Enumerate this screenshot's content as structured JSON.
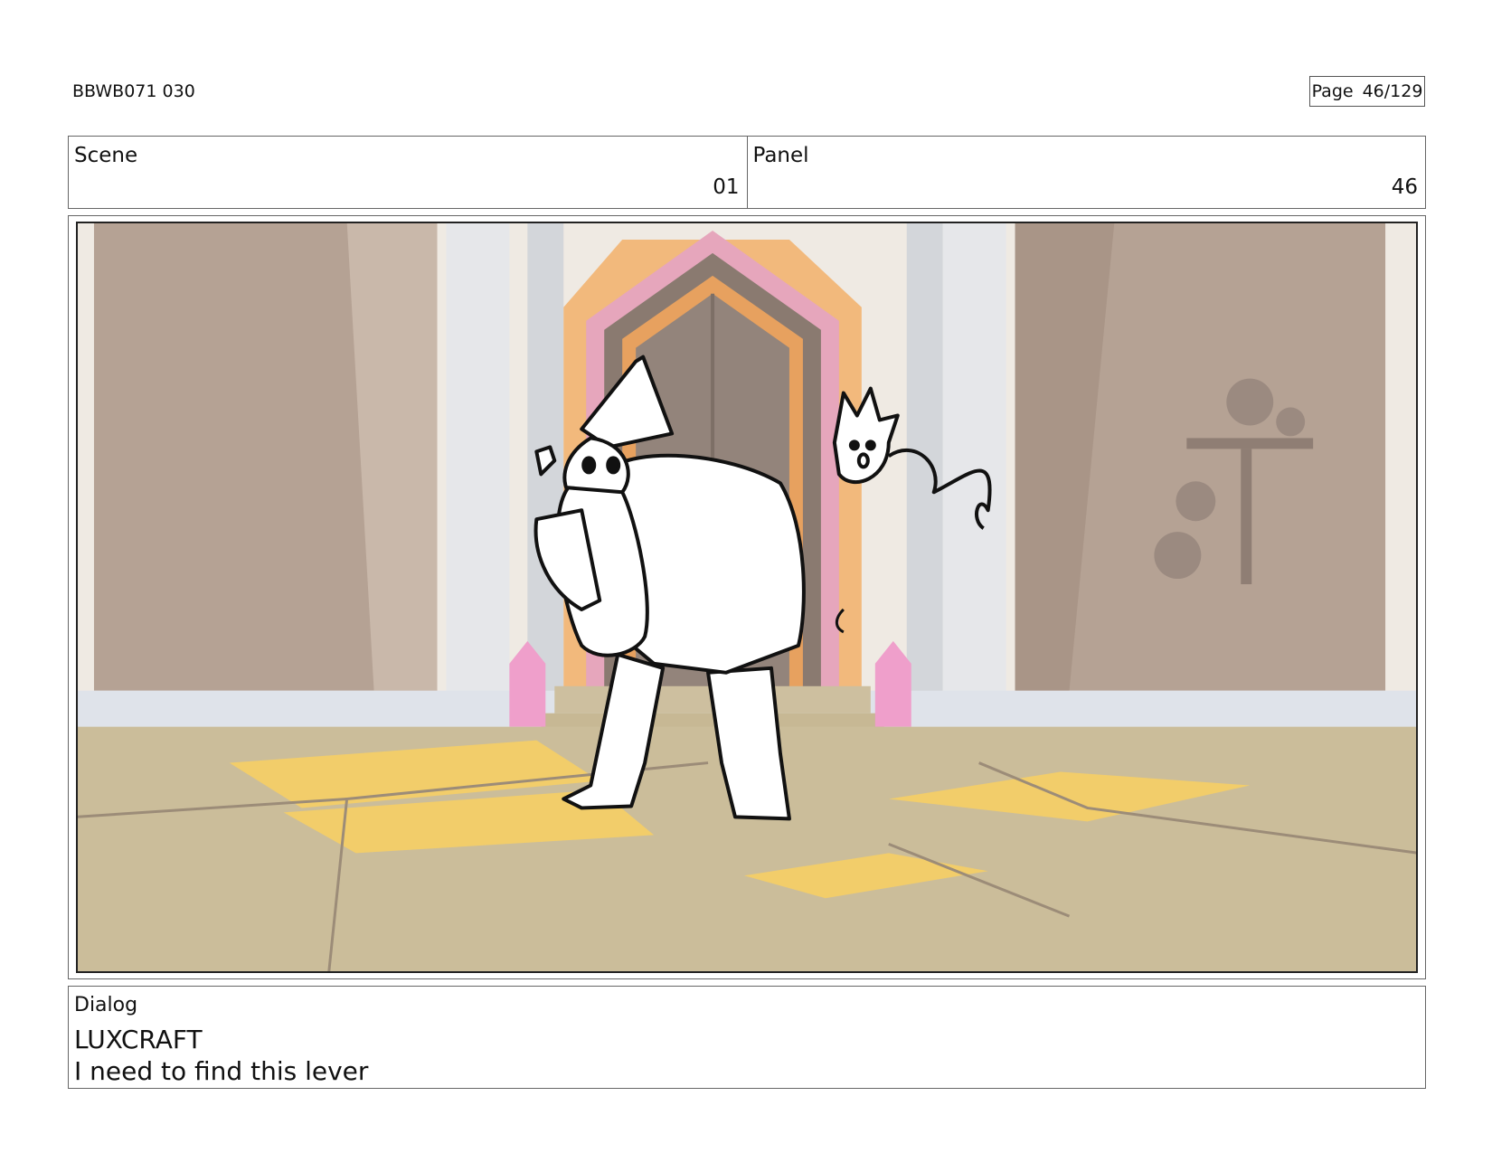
{
  "header": {
    "production_id": "BBWB071 030",
    "page_label": "Page",
    "page_number": "46/129"
  },
  "scene": {
    "label": "Scene",
    "value": "01"
  },
  "panel": {
    "label": "Panel",
    "value": "46"
  },
  "dialog": {
    "label": "Dialog",
    "speaker": "LUXCRAFT",
    "line": "I need to find this lever"
  },
  "colors": {
    "border": "#666666",
    "floor": "#cbbd9a",
    "floor_highlight": "#f2cd6a",
    "wall": "#b5a294",
    "crystal": "#ef9fcb",
    "door_orange": "#f2b97c"
  }
}
